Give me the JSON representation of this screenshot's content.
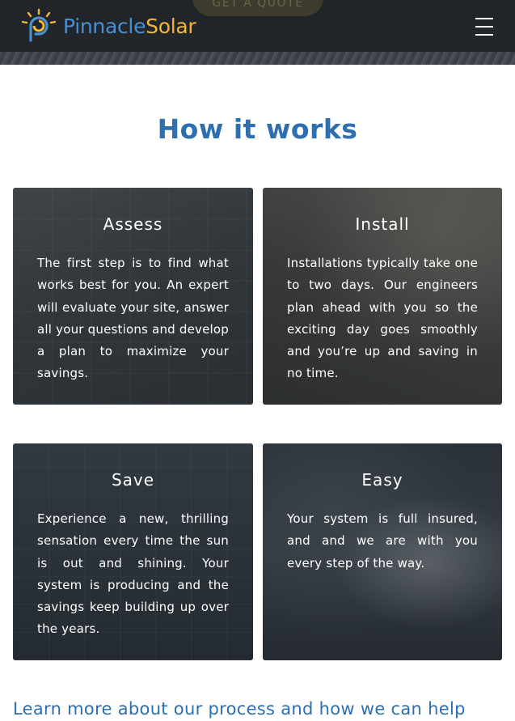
{
  "header": {
    "brand_part_1": "Pinnacle",
    "brand_part_2": "Solar",
    "quote_button_label": "GET A QUOTE",
    "menu_icon": "hamburger-menu-icon",
    "logo_icon": "sun-logo-icon"
  },
  "section": {
    "title": "How it works",
    "cards": [
      {
        "title": "Assess",
        "text": "The first step is to find what works best for you. An expert will evaluate your site, answer all your questions and develop a plan to maximize your savings."
      },
      {
        "title": "Install",
        "text": "Installations typically take one to two days. Our engineers plan ahead with you so the exciting day goes smoothly and you’re up and saving in no time."
      },
      {
        "title": "Save",
        "text": "Experience a new, thrilling sensation every time the sun is out and shining. Your system is producing and the savings keep building up over the years."
      },
      {
        "title": "Easy",
        "text": "Your system is full insured, and and we are with you every step of the way."
      }
    ],
    "learn_more": "Learn more about our process and how we can help"
  },
  "colors": {
    "brand_blue": "#4a90d0",
    "brand_yellow": "#f1b63c",
    "heading_blue": "#2f6fae",
    "header_dark": "#212428"
  }
}
